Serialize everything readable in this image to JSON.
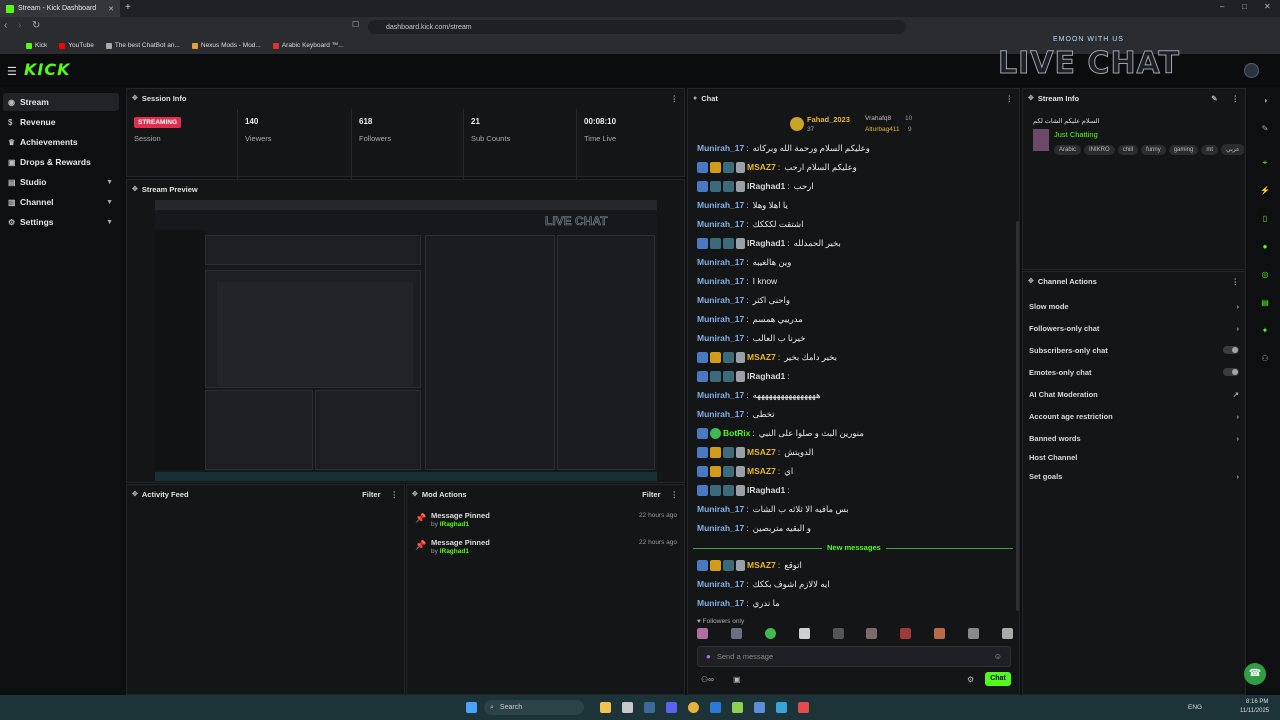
{
  "browser": {
    "tab_title": "Stream - Kick Dashboard",
    "url": "dashboard.kick.com/stream",
    "bookmarks": [
      "Kick",
      "YouTube",
      "The best ChatBot an...",
      "Nexus Mods - Mod...",
      "Arabic Keyboard ™..."
    ]
  },
  "app": {
    "logo": "KICK",
    "overlay_small": "EMOON WITH US",
    "overlay_big": "LIVE CHAT"
  },
  "sidebar": {
    "items": [
      {
        "label": "Stream",
        "icon": "stream-icon"
      },
      {
        "label": "Revenue",
        "icon": "dollar-icon"
      },
      {
        "label": "Achievements",
        "icon": "trophy-icon"
      },
      {
        "label": "Drops & Rewards",
        "icon": "gift-icon"
      },
      {
        "label": "Studio",
        "icon": "studio-icon"
      },
      {
        "label": "Channel",
        "icon": "channel-icon"
      },
      {
        "label": "Settings",
        "icon": "gear-icon"
      }
    ]
  },
  "session": {
    "title": "Session Info",
    "status": "STREAMING",
    "status_label": "Session",
    "viewers": "140",
    "viewers_label": "Viewers",
    "followers": "618",
    "followers_label": "Followers",
    "subs": "21",
    "subs_label": "Sub Counts",
    "time": "00:08:10",
    "time_label": "Time Live"
  },
  "preview": {
    "title": "Stream Preview"
  },
  "activity": {
    "title": "Activity Feed",
    "filter": "Filter"
  },
  "mod": {
    "title": "Mod Actions",
    "filter": "Filter",
    "items": [
      {
        "action": "Message Pinned",
        "by": "by",
        "user": "lRaghad1",
        "time": "22 hours ago"
      },
      {
        "action": "Message Pinned",
        "by": "by",
        "user": "lRaghad1",
        "time": "22 hours ago"
      }
    ]
  },
  "chat": {
    "title": "Chat",
    "top": [
      {
        "name": "Fahad_2023",
        "count": "37"
      },
      {
        "name": "Vrahafq8",
        "count": "10"
      },
      {
        "name": "Alturbag411",
        "count": "9"
      }
    ],
    "new_messages": "New messages",
    "followers_only": "Followers only",
    "input_placeholder": "Send a message",
    "send_label": "Chat",
    "messages": [
      {
        "user": "Munirah_17",
        "color": "#7fb0e8",
        "msg": "وعليكم السلام ورحمة الله وبركاته",
        "badges": []
      },
      {
        "user": "MSAZ7",
        "color": "#e5b52a",
        "msg": "وعليكم السلام ارحب",
        "badges": [
          "b1",
          "b2",
          "b3",
          "b4"
        ]
      },
      {
        "user": "lRaghad1",
        "color": "#d8d8d8",
        "msg": "ارحب",
        "badges": [
          "b1",
          "b3",
          "b3",
          "b4"
        ]
      },
      {
        "user": "Munirah_17",
        "color": "#7fb0e8",
        "msg": "يا اهلا وهلا",
        "badges": []
      },
      {
        "user": "Munirah_17",
        "color": "#7fb0e8",
        "msg": "اشتقت لكككك",
        "badges": []
      },
      {
        "user": "lRaghad1",
        "color": "#d8d8d8",
        "msg": "بخير الحمدلله",
        "badges": [
          "b1",
          "b3",
          "b3",
          "b4"
        ]
      },
      {
        "user": "Munirah_17",
        "color": "#7fb0e8",
        "msg": "وين هالغيبه",
        "badges": []
      },
      {
        "user": "Munirah_17",
        "color": "#7fb0e8",
        "msg": "I know",
        "badges": []
      },
      {
        "user": "Munirah_17",
        "color": "#7fb0e8",
        "msg": "واحنى اكثر",
        "badges": []
      },
      {
        "user": "Munirah_17",
        "color": "#7fb0e8",
        "msg": "مدريبي همسم",
        "badges": []
      },
      {
        "user": "Munirah_17",
        "color": "#7fb0e8",
        "msg": "خيرنا ب العالب",
        "badges": []
      },
      {
        "user": "MSAZ7",
        "color": "#e5b52a",
        "msg": "بخير دامك بخير",
        "badges": [
          "b1",
          "b2",
          "b3",
          "b4"
        ]
      },
      {
        "user": "lRaghad1",
        "color": "#d8d8d8",
        "msg": "",
        "badges": [
          "b1",
          "b3",
          "b3",
          "b4"
        ]
      },
      {
        "user": "Munirah_17",
        "color": "#7fb0e8",
        "msg": "ههههههههههههههههه",
        "badges": []
      },
      {
        "user": "Munirah_17",
        "color": "#7fb0e8",
        "msg": "تخطى",
        "badges": []
      },
      {
        "user": "BotRix",
        "color": "#53fc18",
        "msg": "منورين البث و صلوا على النبي",
        "badges": [
          "b1",
          "b5"
        ]
      },
      {
        "user": "MSAZ7",
        "color": "#e5b52a",
        "msg": "الدويتش",
        "badges": [
          "b1",
          "b2",
          "b3",
          "b4"
        ]
      },
      {
        "user": "MSAZ7",
        "color": "#e5b52a",
        "msg": "اي",
        "badges": [
          "b1",
          "b2",
          "b3",
          "b4"
        ]
      },
      {
        "user": "lRaghad1",
        "color": "#d8d8d8",
        "msg": "",
        "badges": [
          "b1",
          "b3",
          "b3",
          "b4"
        ]
      },
      {
        "user": "Munirah_17",
        "color": "#7fb0e8",
        "msg": "بس مافيه الا ثلاثه ب الشات",
        "badges": []
      },
      {
        "user": "Munirah_17",
        "color": "#7fb0e8",
        "msg": "و البقيه متربصين",
        "badges": []
      }
    ],
    "after_new": [
      {
        "user": "MSAZ7",
        "color": "#e5b52a",
        "msg": "اتوقع",
        "badges": [
          "b1",
          "b2",
          "b3",
          "b4"
        ]
      },
      {
        "user": "Munirah_17",
        "color": "#7fb0e8",
        "msg": "ايه لالازم اشوف بككك",
        "badges": []
      },
      {
        "user": "Munirah_17",
        "color": "#7fb0e8",
        "msg": "ما ندري",
        "badges": []
      }
    ]
  },
  "stream_info": {
    "title": "Stream Info",
    "stream_title": "السلام عليكم الشات لكم",
    "category": "Just Chatting",
    "tags": [
      "Arabic",
      "INIKRO",
      "chill",
      "funny",
      "gaming",
      "mt",
      "عربي"
    ]
  },
  "channel_actions": {
    "title": "Channel Actions",
    "items": [
      {
        "label": "Slow mode",
        "kind": "chev"
      },
      {
        "label": "Followers-only chat",
        "kind": "chev"
      },
      {
        "label": "Subscribers-only chat",
        "kind": "toggle"
      },
      {
        "label": "Emotes-only chat",
        "kind": "toggle"
      },
      {
        "label": "AI Chat Moderation",
        "kind": "ext"
      },
      {
        "label": "Account age restriction",
        "kind": "chev"
      },
      {
        "label": "Banned words",
        "kind": "chev"
      },
      {
        "label": "Host Channel",
        "kind": "none"
      },
      {
        "label": "Set goals",
        "kind": "chev"
      }
    ]
  },
  "taskbar": {
    "search": "Search",
    "lang": "ENG",
    "time": "8:16 PM",
    "date": "11/11/2025"
  }
}
